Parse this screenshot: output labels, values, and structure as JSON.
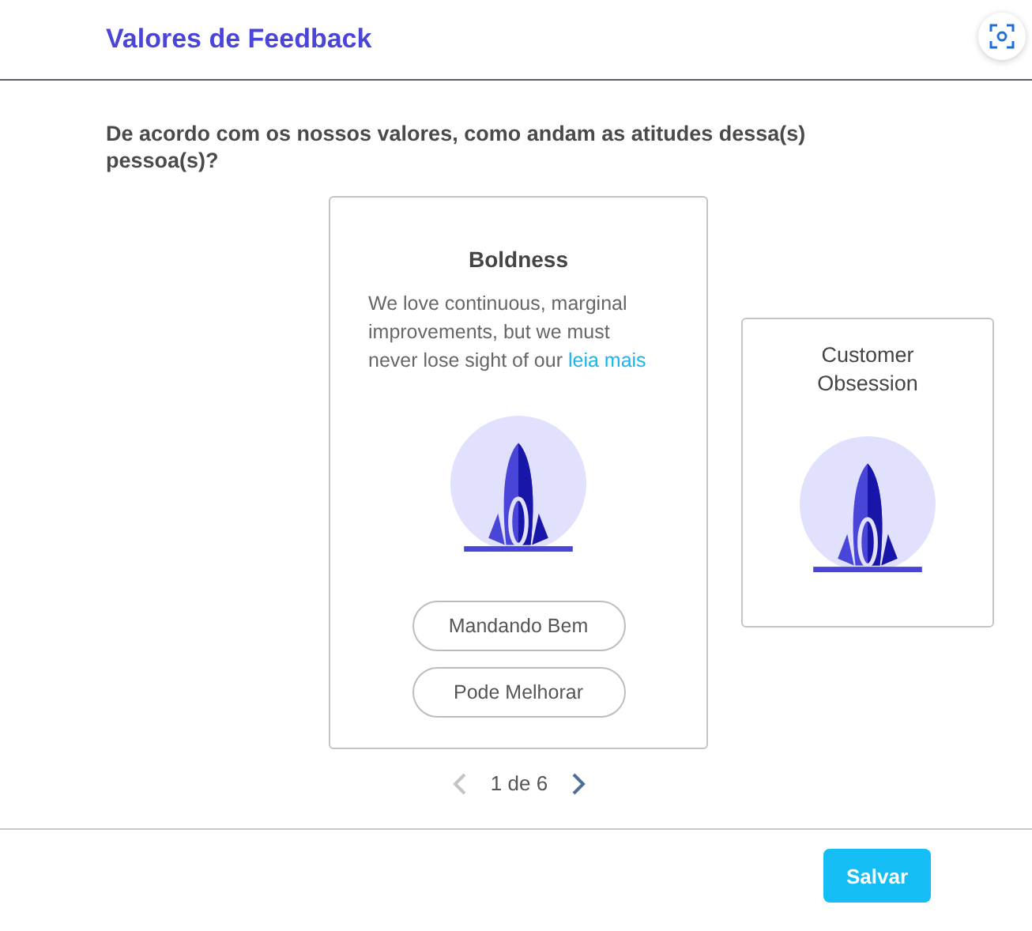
{
  "header": {
    "title": "Valores de Feedback"
  },
  "question": "De acordo com os nossos valores, como andam as atitudes dessa(s) pessoa(s)?",
  "cards": [
    {
      "title": "Boldness",
      "selected": true,
      "description": "We love continuous, marginal improvements, but we must never lose sight of our",
      "more_link": "leia mais",
      "options": [
        "Mandando Bem",
        "Pode Melhorar"
      ]
    },
    {
      "title": "Customer Obsession",
      "selected": false
    }
  ],
  "pager": {
    "label": "1 de 6",
    "prev_disabled": true,
    "next_disabled": false
  },
  "footer": {
    "save_button": "Salvar"
  }
}
